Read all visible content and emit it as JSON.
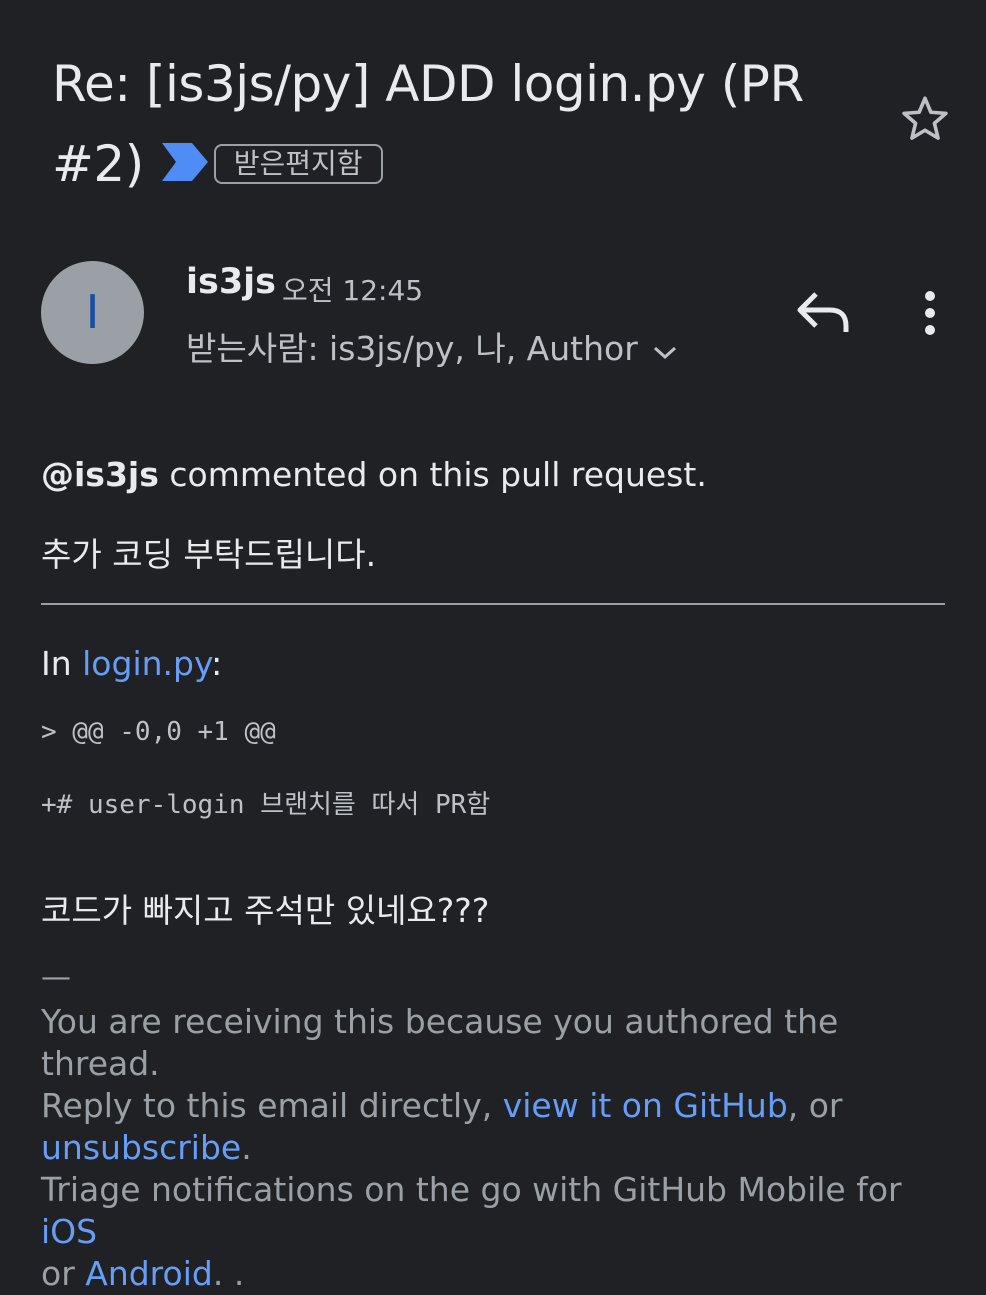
{
  "subject": {
    "title": "Re: [is3js/py] ADD login.py (PR #2)",
    "label": "받은편지함"
  },
  "sender": {
    "avatar_letter": "I",
    "name": "is3js",
    "time": "오전 12:45",
    "recipients": "받는사람: is3js/py, 나, Author"
  },
  "colors": {
    "background": "#202124",
    "link": "#669df6",
    "importance": "#4f8cf6",
    "avatar": "#9aa0a6"
  },
  "icons": [
    "star-icon",
    "importance-marker-icon",
    "chevron-down-icon",
    "reply-icon",
    "more-vert-icon"
  ],
  "body": {
    "mention": "@is3js",
    "comment_intro": " commented on this pull request.",
    "comment_text": "추가 코딩 부탁드립니다.",
    "in_prefix": "In ",
    "file_link": "login.py",
    "in_suffix": ":",
    "diff_header": "> @@ -0,0 +1 @@",
    "diff_line": "+# user-login 브랜치를 따서 PR함",
    "review_comment": "코드가 빠지고 주석만 있네요???"
  },
  "footer": {
    "dash": "—",
    "line1": "You are receiving this because you authored the thread.",
    "line2_prefix": "Reply to this email directly, ",
    "view_link": "view it on GitHub",
    "line2_suffix": ", or",
    "unsubscribe_link": "unsubscribe",
    "unsubscribe_suffix": ".",
    "line3_prefix": "Triage notifications on the go with GitHub Mobile for ",
    "ios_link": "iOS",
    "line4_prefix": "or ",
    "android_link": "Android",
    "line4_suffix": ". ."
  }
}
